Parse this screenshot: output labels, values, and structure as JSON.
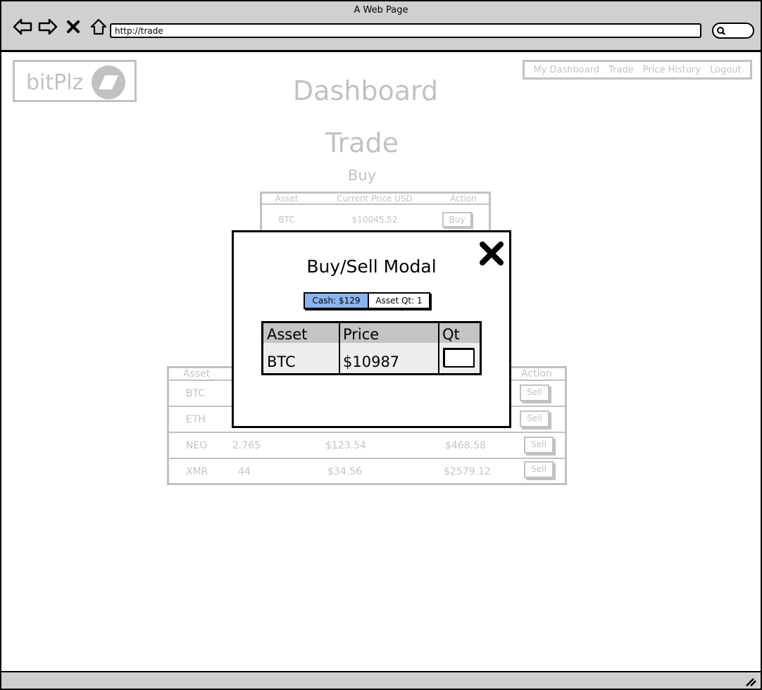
{
  "browser": {
    "window_title": "A Web Page",
    "url": "http://trade"
  },
  "header": {
    "logo_text": "bitPlz",
    "nav": [
      "My Dashboard",
      "Trade",
      "Price History",
      "Logout"
    ]
  },
  "page": {
    "dashboard_title": "Dashboard",
    "trade_title": "Trade",
    "buy_title": "Buy"
  },
  "buy_table": {
    "headers": [
      "Asset",
      "Current Price USD",
      "Action"
    ],
    "rows": [
      {
        "asset": "BTC",
        "price": "$10045.52",
        "action": "Buy"
      }
    ]
  },
  "sell_table": {
    "headers": [
      "Asset",
      "Action"
    ],
    "rows": [
      {
        "asset": "BTC",
        "qty": "",
        "price": "",
        "value": "",
        "action": "Sell"
      },
      {
        "asset": "ETH",
        "qty": "",
        "price": "",
        "value": "",
        "action": "Sell"
      },
      {
        "asset": "NEO",
        "qty": "2.765",
        "price": "$123.54",
        "value": "$468.58",
        "action": "Sell"
      },
      {
        "asset": "XMR",
        "qty": "44",
        "price": "$34.56",
        "value": "$2579.12",
        "action": "Sell"
      }
    ]
  },
  "modal": {
    "title": "Buy/Sell Modal",
    "cash": "Cash: $129",
    "asset_qt": "Asset Qt: 1",
    "table": {
      "headers": [
        "Asset",
        "Price",
        "Qt"
      ],
      "row": {
        "asset": "BTC",
        "price": "$10987",
        "qt": ""
      }
    },
    "cash_highlight_color": "#8ab4f0"
  }
}
